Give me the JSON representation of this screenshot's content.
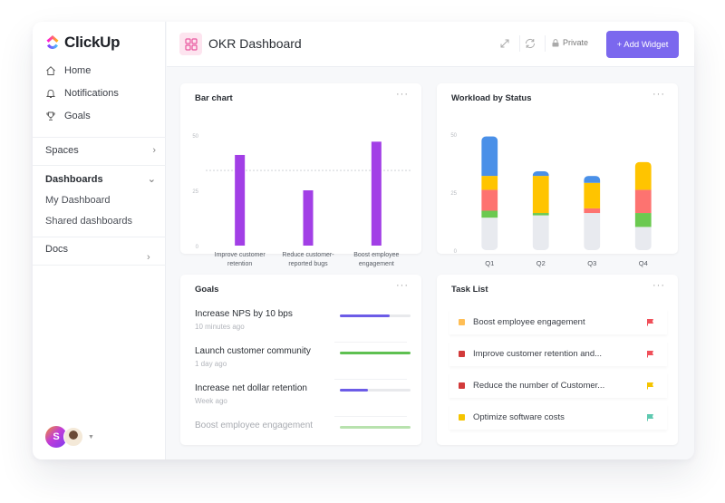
{
  "app": {
    "name": "ClickUp"
  },
  "sidebar": {
    "nav": [
      {
        "label": "Home",
        "icon": "home-icon"
      },
      {
        "label": "Notifications",
        "icon": "bell-icon"
      },
      {
        "label": "Goals",
        "icon": "trophy-icon"
      }
    ],
    "spaces_label": "Spaces",
    "dashboards_label": "Dashboards",
    "dashboards_items": [
      "My Dashboard",
      "Shared dashboards"
    ],
    "docs_label": "Docs",
    "user_initial": "S"
  },
  "topbar": {
    "title": "OKR Dashboard",
    "private_label": "Private",
    "add_widget_label": "+ Add Widget"
  },
  "colors": {
    "accent": "#7b68ee",
    "bar_purple": "#a23fe6",
    "blue": "#4a90e8",
    "yellow": "#ffc400",
    "red": "#fd7370",
    "green": "#6bc950",
    "gray": "#e8eaef"
  },
  "chart_data": [
    {
      "type": "bar",
      "title": "Bar chart",
      "categories": [
        "Improve customer retention",
        "Reduce customer-reported bugs",
        "Boost employee engagement"
      ],
      "category_lines": [
        [
          "Improve customer",
          "retention"
        ],
        [
          "Reduce customer-",
          "reported bugs"
        ],
        [
          "Boost employee",
          "engagement"
        ]
      ],
      "values": [
        41,
        25,
        47
      ],
      "reference_line": 34,
      "yticks": [
        0,
        25,
        50
      ],
      "ylim": [
        0,
        50
      ],
      "xlabel": "",
      "ylabel": ""
    },
    {
      "type": "bar",
      "stacked": true,
      "title": "Workload by Status",
      "categories": [
        "Q1",
        "Q2",
        "Q3",
        "Q4"
      ],
      "series": [
        {
          "name": "gray",
          "color": "#e8eaef",
          "values": [
            14,
            15,
            16,
            10
          ]
        },
        {
          "name": "green",
          "color": "#6bc950",
          "values": [
            3,
            1,
            0,
            6
          ]
        },
        {
          "name": "red",
          "color": "#fd7370",
          "values": [
            9,
            0,
            2,
            10
          ]
        },
        {
          "name": "yellow",
          "color": "#ffc400",
          "values": [
            6,
            16,
            11,
            12
          ]
        },
        {
          "name": "blue",
          "color": "#4a90e8",
          "values": [
            17,
            2,
            3,
            0
          ]
        }
      ],
      "yticks": [
        0,
        25,
        50
      ],
      "ylim": [
        0,
        50
      ],
      "xlabel": "",
      "ylabel": ""
    }
  ],
  "goals": {
    "title": "Goals",
    "items": [
      {
        "name": "Increase NPS by 10 bps",
        "time": "10 minutes ago",
        "progress": 0.7,
        "color": "#6c5ce7"
      },
      {
        "name": "Launch customer community",
        "time": "1 day ago",
        "progress": 1.0,
        "color": "#5ec051"
      },
      {
        "name": "Increase net dollar retention",
        "time": "Week ago",
        "progress": 0.4,
        "color": "#6c5ce7"
      },
      {
        "name": "Boost employee engagement",
        "time": "",
        "progress": 1.0,
        "color": "#b8e2ae"
      }
    ]
  },
  "tasks": {
    "title": "Task List",
    "items": [
      {
        "name": "Boost employee engagement",
        "status_color": "#ffbe55",
        "flag_color": "#f0505a"
      },
      {
        "name": "Improve customer retention and...",
        "status_color": "#d23a3a",
        "flag_color": "#f0505a"
      },
      {
        "name": "Reduce the number of Customer...",
        "status_color": "#d23a3a",
        "flag_color": "#f5c400"
      },
      {
        "name": "Optimize software costs",
        "status_color": "#f5c400",
        "flag_color": "#5ec9b0"
      }
    ]
  }
}
